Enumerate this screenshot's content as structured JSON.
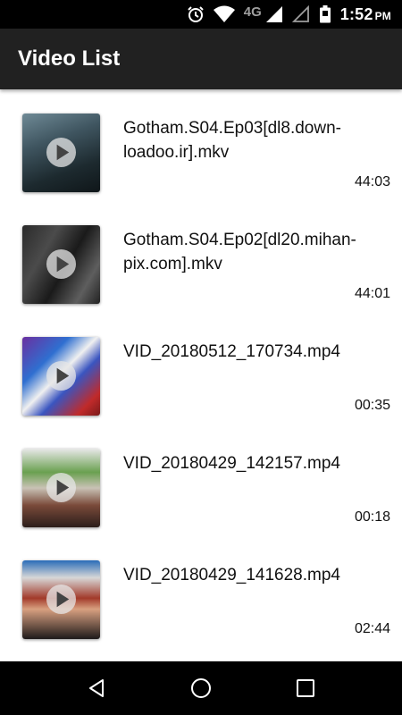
{
  "status_bar": {
    "network": "4G",
    "time": "1:52",
    "ampm": "PM",
    "icons": [
      "alarm-icon",
      "wifi-icon",
      "signal-icon",
      "signal-empty-icon",
      "battery-icon"
    ]
  },
  "app_bar": {
    "title": "Video List"
  },
  "videos": [
    {
      "title": "Gotham.S04.Ep03[dl8.down-loadoo.ir].mkv",
      "duration": "44:03"
    },
    {
      "title": "Gotham.S04.Ep02[dl20.mihan-pix.com].mkv",
      "duration": "44:01"
    },
    {
      "title": "VID_20180512_170734.mp4",
      "duration": "00:35"
    },
    {
      "title": "VID_20180429_142157.mp4",
      "duration": "00:18"
    },
    {
      "title": "VID_20180429_141628.mp4",
      "duration": "02:44"
    }
  ],
  "nav_bar": {
    "icons": [
      "back-icon",
      "home-icon",
      "recents-icon"
    ]
  },
  "colors": {
    "app_bar": "#212121",
    "status_bar": "#000000",
    "nav_bar": "#000000",
    "background": "#ffffff",
    "text": "#111111"
  }
}
